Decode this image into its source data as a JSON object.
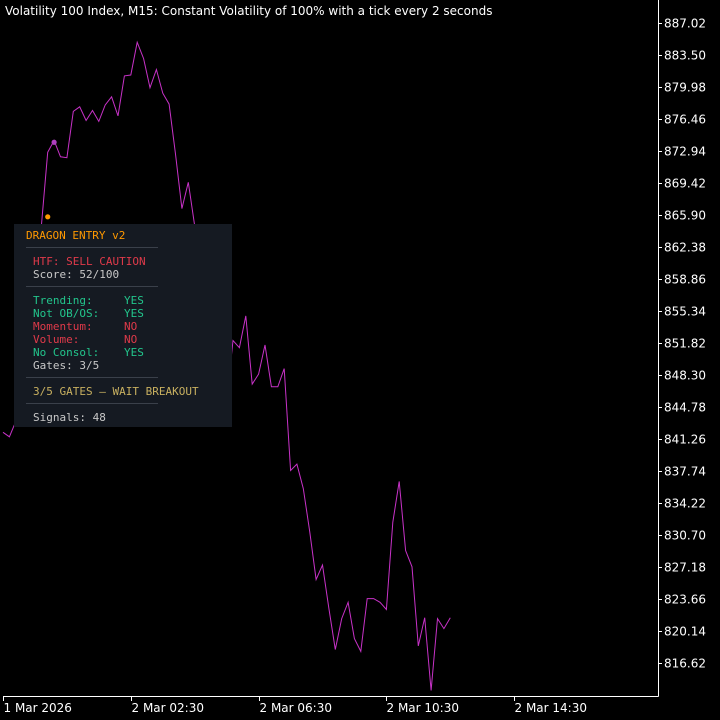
{
  "chart_title": "Volatility 100 Index, M15:  Constant Volatility of 100% with a tick every 2 seconds",
  "colors": {
    "background": "#000000",
    "line": "#c832c8",
    "axis": "#ffffff",
    "panel_bg": "#151a22",
    "orange": "#ff9900",
    "red": "#e03a4a",
    "green": "#22c58c",
    "gold": "#c8b060",
    "grey": "#c8c8c8",
    "magenta_marker": "#b040c0"
  },
  "chart_data": {
    "type": "line",
    "title": "Volatility 100 Index, M15:  Constant Volatility of 100% with a tick every 2 seconds",
    "xlabel": "",
    "ylabel": "",
    "ylim": [
      813.0,
      889.0
    ],
    "xlim": [
      0,
      80
    ],
    "grid": false,
    "y_ticks": [
      "887.02",
      "883.50",
      "879.98",
      "876.46",
      "872.94",
      "869.42",
      "865.90",
      "862.38",
      "858.86",
      "855.34",
      "851.82",
      "848.30",
      "844.78",
      "841.26",
      "837.74",
      "834.22",
      "830.70",
      "827.18",
      "823.66",
      "820.14",
      "816.62"
    ],
    "x_tick_labels": [
      {
        "label": "1 Mar 2026",
        "bar": 0
      },
      {
        "label": "2 Mar 02:30",
        "bar": 20
      },
      {
        "label": "2 Mar 06:30",
        "bar": 40
      },
      {
        "label": "2 Mar 10:30",
        "bar": 60
      },
      {
        "label": "2 Mar 14:30",
        "bar": 80
      }
    ],
    "series": [
      {
        "values": [
          842.0,
          841.5,
          843.2,
          845.8,
          846.7,
          856.1,
          864.6,
          872.8,
          874.1,
          872.3,
          872.2,
          877.3,
          877.8,
          876.3,
          877.4,
          876.2,
          878.0,
          878.9,
          876.8,
          881.2,
          881.3,
          884.9,
          883.1,
          879.9,
          881.9,
          879.3,
          878.1,
          872.6,
          866.6,
          869.5,
          864.7,
          861.5,
          854.1,
          849.3,
          845.5,
          845.4,
          852.1,
          851.3,
          854.8,
          847.3,
          848.4,
          851.6,
          847.0,
          847.0,
          849.0,
          837.8,
          838.5,
          835.8,
          831.1,
          825.8,
          827.4,
          822.6,
          818.1,
          821.5,
          823.3,
          819.3,
          817.9,
          823.7,
          823.7,
          823.3,
          822.5,
          832.1,
          836.6,
          829.0,
          827.2,
          818.5,
          821.6,
          813.6,
          821.5,
          820.4,
          821.6
        ]
      }
    ],
    "markers": [
      {
        "bar": 7,
        "value": 865.7,
        "color": "#ff9900"
      },
      {
        "bar": 8,
        "value": 873.9,
        "color": "#b040c0"
      },
      {
        "bar": 6,
        "value": 858.1,
        "color": "#22c58c"
      }
    ],
    "arrow": {
      "bar": 5,
      "value": 856.5,
      "color": "#22c58c",
      "direction": "up"
    }
  },
  "panel": {
    "title": "DRAGON ENTRY v2",
    "htf": "HTF: SELL CAUTION",
    "score": "Score: 52/100",
    "indicators": [
      {
        "label": "Trending:",
        "value": "YES",
        "color": "#22c58c"
      },
      {
        "label": "Not OB/OS:",
        "value": "YES",
        "color": "#22c58c"
      },
      {
        "label": "Momentum:",
        "value": "NO",
        "color": "#e03a4a"
      },
      {
        "label": "Volume:",
        "value": "NO",
        "color": "#e03a4a"
      },
      {
        "label": "No Consol:",
        "value": "YES",
        "color": "#22c58c"
      }
    ],
    "gates": "Gates: 3/5",
    "status": "3/5 GATES — WAIT BREAKOUT",
    "signals": "Signals: 48"
  }
}
